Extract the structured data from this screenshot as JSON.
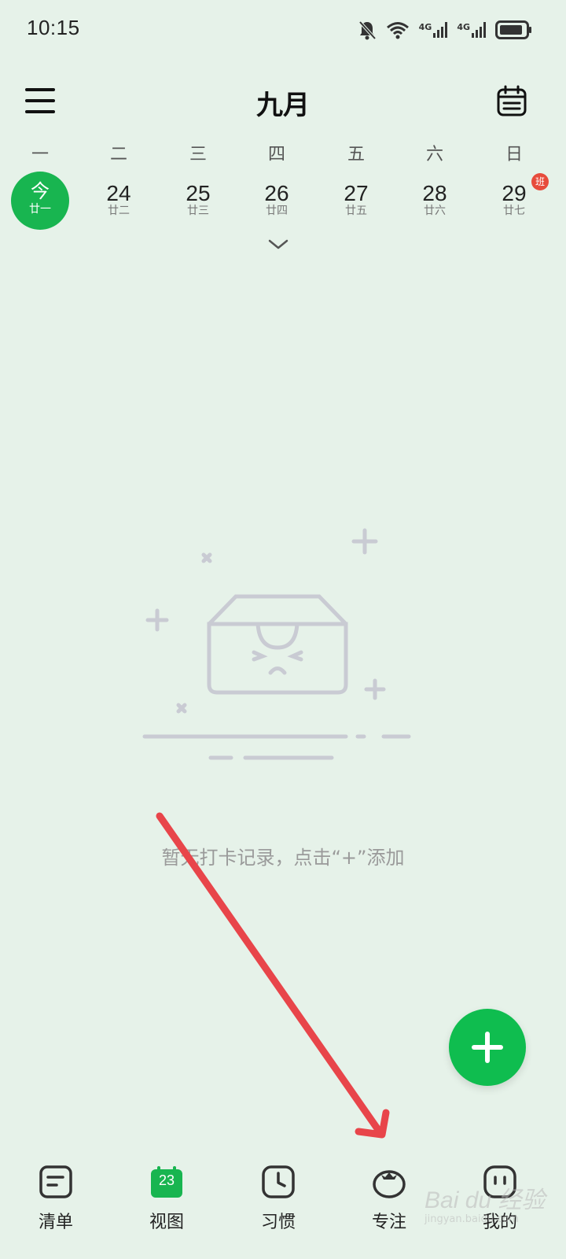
{
  "status_bar": {
    "time": "10:15",
    "network_1": "4G",
    "network_2": "4G"
  },
  "header": {
    "title": "九月"
  },
  "week": {
    "weekdays": [
      "一",
      "二",
      "三",
      "四",
      "五",
      "六",
      "日"
    ],
    "today": {
      "label": "今",
      "lunar": "廿一"
    },
    "days": [
      {
        "day": "24",
        "lunar": "廿二"
      },
      {
        "day": "25",
        "lunar": "廿三"
      },
      {
        "day": "26",
        "lunar": "廿四"
      },
      {
        "day": "27",
        "lunar": "廿五"
      },
      {
        "day": "28",
        "lunar": "廿六"
      },
      {
        "day": "29",
        "lunar": "廿七"
      }
    ],
    "holiday_badge": "班"
  },
  "empty_state": {
    "message": "暂无打卡记录，点击“+”添加"
  },
  "bottom_nav": {
    "items": [
      {
        "label": "清单",
        "icon": "list-icon"
      },
      {
        "label": "视图",
        "icon": "calendar-view-icon",
        "badge": "23"
      },
      {
        "label": "习惯",
        "icon": "clock-icon"
      },
      {
        "label": "专注",
        "icon": "tomato-icon"
      },
      {
        "label": "我的",
        "icon": "profile-icon"
      }
    ]
  },
  "watermark": {
    "text": "Bai du 经验",
    "url": "jingyan.baidu.com"
  },
  "colors": {
    "background": "#e6f2e9",
    "accent_green": "#18b550",
    "badge_red": "#e74c3c",
    "annotation_red": "#e8454a"
  }
}
